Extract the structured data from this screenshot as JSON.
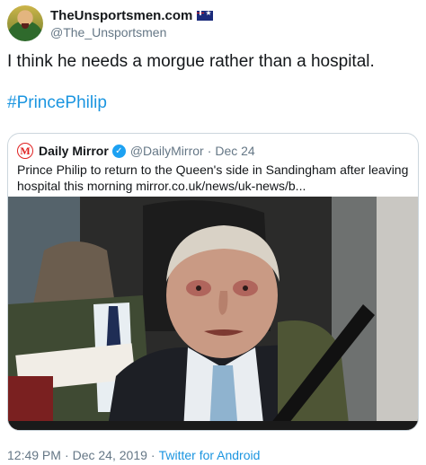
{
  "author": {
    "display_name": "TheUnsportsmen.com",
    "handle": "@The_Unsportsmen",
    "flag_icon": "australia-flag-icon"
  },
  "tweet": {
    "text": "I think he needs a morgue rather than a hospital.",
    "hashtag": "#PrincePhilip"
  },
  "quoted_tweet": {
    "logo_letter": "M",
    "name": "Daily Mirror",
    "handle": "@DailyMirror",
    "dot": "·",
    "date": "Dec 24",
    "text": "Prince Philip to return to the Queen's side in Sandingham after leaving hospital this morning mirror.co.uk/news/uk-news/b..."
  },
  "meta": {
    "time": "12:49 PM",
    "sep1": "·",
    "date": "Dec 24, 2019",
    "sep2": "·",
    "source": "Twitter for Android"
  },
  "colors": {
    "link": "#1b95e0",
    "verified": "#1da1f2",
    "muted": "#657786",
    "border": "#ccd6dd",
    "mirror_red": "#e02020"
  }
}
